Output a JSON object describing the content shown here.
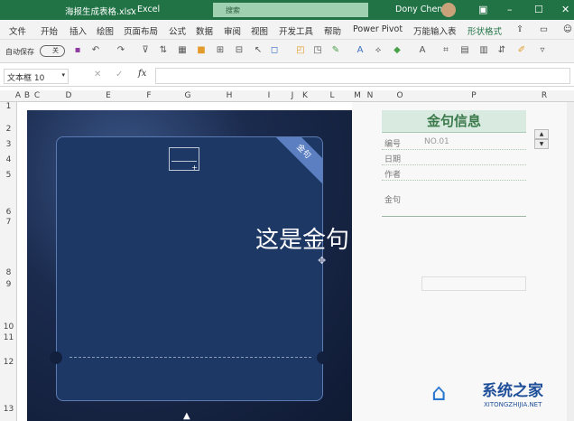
{
  "title": {
    "file": "海报生成表格.xlsx",
    "app": "Excel",
    "search_placeholder": "搜索",
    "user": "Dony Chen"
  },
  "menu": [
    "文件",
    "开始",
    "插入",
    "绘图",
    "页面布局",
    "公式",
    "数据",
    "审阅",
    "视图",
    "开发工具",
    "帮助",
    "Power Pivot",
    "万能输入表",
    "形状格式"
  ],
  "toolbar": {
    "autosave": "自动保存",
    "autosave_state": "关"
  },
  "formula": {
    "namebox": "文本框 10",
    "fx": "fx"
  },
  "columns": [
    "A",
    "B",
    "C",
    "D",
    "E",
    "F",
    "G",
    "H",
    "I",
    "J",
    "K",
    "L",
    "M",
    "N",
    "O",
    "P",
    "R"
  ],
  "rows": [
    "1",
    "2",
    "3",
    "4",
    "5",
    "6",
    "7",
    "8",
    "9",
    "10",
    "11",
    "12",
    "13"
  ],
  "poster": {
    "ribbon": "金句",
    "text": "这是金句"
  },
  "panel": {
    "title": "金句信息",
    "fields": [
      {
        "label": "编号",
        "value": "NO.01"
      },
      {
        "label": "日期",
        "value": ""
      },
      {
        "label": "作者",
        "value": ""
      },
      {
        "label": "金句",
        "value": ""
      }
    ]
  },
  "watermark": {
    "name": "系统之家",
    "url": "XITONGZHIJIA.NET"
  },
  "colors": {
    "excel_green": "#217346",
    "panel_header": "#d9ebe0",
    "card": "#1e3866"
  }
}
